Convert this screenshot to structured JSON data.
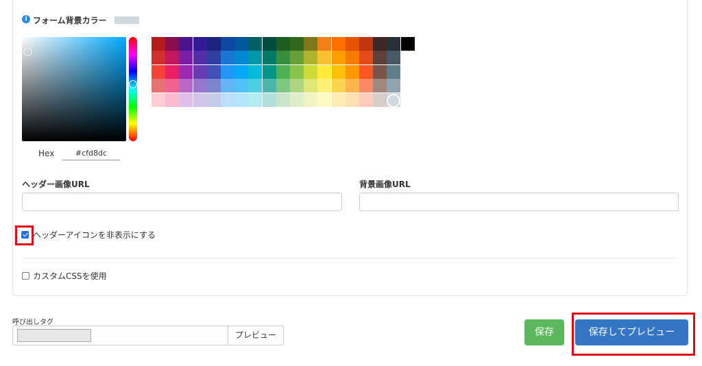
{
  "form_bg": {
    "label": "フォーム背景カラー",
    "info_icon": "info-icon",
    "current_color": "#cfd8dc",
    "hex_label": "Hex",
    "hex_value": "#cfd8dc"
  },
  "palette": {
    "rows": [
      [
        "#b71c1c",
        "#880e4f",
        "#4a148c",
        "#311b92",
        "#1a237e",
        "#0d47a1",
        "#01579b",
        "#006064",
        "#004d40",
        "#1b5e20",
        "#33691e",
        "#827717",
        "#f57f17",
        "#ff6f00",
        "#e65100",
        "#bf360c",
        "#3e2723",
        "#263238",
        "#000000"
      ],
      [
        "#d32f2f",
        "#c2185b",
        "#7b1fa2",
        "#512da8",
        "#303f9f",
        "#1976d2",
        "#0288d1",
        "#0097a7",
        "#00796b",
        "#388e3c",
        "#689f38",
        "#afb42b",
        "#fbc02d",
        "#ffa000",
        "#f57c00",
        "#e64a19",
        "#5d4037",
        "#455a64",
        "#ffffff"
      ],
      [
        "#f44336",
        "#e91e63",
        "#9c27b0",
        "#673ab7",
        "#3f51b5",
        "#2196f3",
        "#03a9f4",
        "#00bcd4",
        "#009688",
        "#4caf50",
        "#8bc34a",
        "#cddc39",
        "#ffeb3b",
        "#ffc107",
        "#ff9800",
        "#ff5722",
        "#795548",
        "#607d8b"
      ],
      [
        "#e57373",
        "#f06292",
        "#ba68c8",
        "#9575cd",
        "#7986cb",
        "#64b5f6",
        "#4fc3f7",
        "#4dd0e1",
        "#4db6ac",
        "#81c784",
        "#aed581",
        "#dce775",
        "#fff176",
        "#ffd54f",
        "#ffb74d",
        "#ff8a65",
        "#a1887f",
        "#90a4ae"
      ],
      [
        "#ffcdd2",
        "#f8bbd0",
        "#e1bee7",
        "#d1c4e9",
        "#c5cae9",
        "#bbdefb",
        "#b3e5fc",
        "#b2ebf2",
        "#b2dfdb",
        "#c8e6c9",
        "#dcedc8",
        "#f0f4c3",
        "#fff9c4",
        "#ffecb3",
        "#ffe0b2",
        "#ffccbc",
        "#d7ccc8",
        "#cfd8dc"
      ]
    ],
    "sv_hue": "#00aaff"
  },
  "fields": {
    "header_image_label": "ヘッダー画像URL",
    "header_image_value": "",
    "bg_image_label": "背景画像URL",
    "bg_image_value": ""
  },
  "options": {
    "hide_header_icon_label": "ヘッダーアイコンを非表示にする",
    "hide_header_icon_checked": true,
    "custom_css_label": "カスタムCSSを使用",
    "custom_css_checked": false
  },
  "footer": {
    "call_tag_label": "呼び出しタグ",
    "call_tag_value": "",
    "preview_button": "プレビュー",
    "save_button": "保存",
    "save_preview_button": "保存してプレビュー"
  }
}
